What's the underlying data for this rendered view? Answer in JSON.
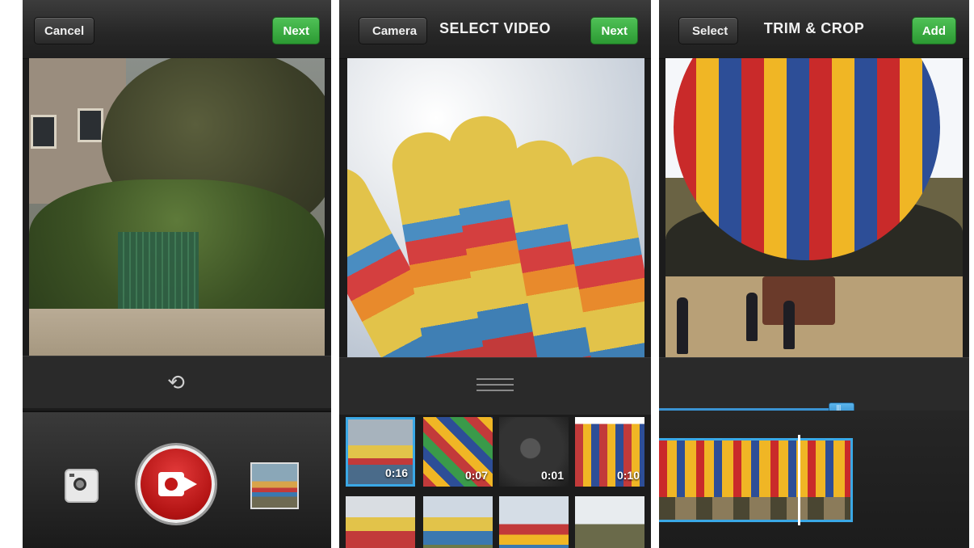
{
  "panel1": {
    "cancel_label": "Cancel",
    "next_label": "Next"
  },
  "panel2": {
    "back_label": "Camera",
    "title": "SELECT VIDEO",
    "next_label": "Next",
    "thumbnails": [
      {
        "duration": "0:16"
      },
      {
        "duration": "0:07"
      },
      {
        "duration": "0:01"
      },
      {
        "duration": "0:10"
      }
    ]
  },
  "panel3": {
    "back_label": "Select",
    "title": "TRIM & CROP",
    "add_label": "Add"
  },
  "icons": {
    "flip_camera": "camera-flip-icon",
    "instagram": "instagram-icon",
    "record": "video-camera-icon"
  },
  "colors": {
    "record_red": "#c21818",
    "accent_green": "#3aa83f",
    "accent_blue": "#3aa8e6"
  }
}
